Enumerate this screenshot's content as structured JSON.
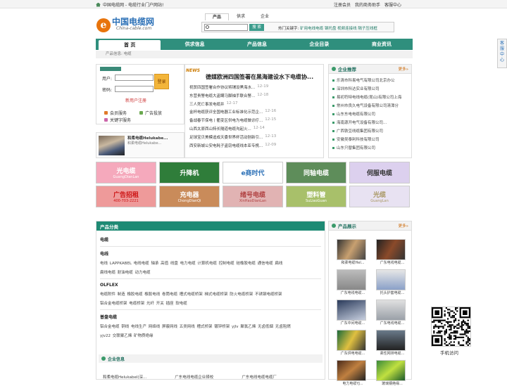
{
  "topbar": {
    "site": "中国电缆网 - 电缆行业门户网站!",
    "register": "注册会员",
    "my_business": "我的商务助手",
    "service": "客服中心"
  },
  "logo": {
    "cn": "中国电缆网",
    "en": "China-cable.com",
    "mark": "e"
  },
  "search": {
    "tabs": [
      "产品",
      "供求",
      "企业"
    ],
    "button": "搜 索",
    "hot_label": "热门关键字:",
    "hot_words": "矿用电线电缆 钢托盘 视频连接线 隔子压线框"
  },
  "nav": [
    "首 页",
    "供求信息",
    "产品信息",
    "企业目录",
    "商业资讯"
  ],
  "breadcrumb": "产品信息: 电缆",
  "login": {
    "user_label": "用户:",
    "pass_label": "密码:",
    "login_button": "登录",
    "register_link": "新用户注册",
    "services": [
      "会员服务",
      "广告投放",
      "关键字服务"
    ]
  },
  "product_card": {
    "name": "和柔电缆Helukabe...",
    "desc": "和柔电缆Helukabe..."
  },
  "news": {
    "tag": "NEWS",
    "headline": "德媒欧洲四国签署在黑海建设水下电缆协...",
    "items": [
      {
        "title": "祝贺四国签署合作协议将铺设黑海水...",
        "date": "12-19"
      },
      {
        "title": "东营贵警电缆大盗瞒马脚袖手联合警...",
        "date": "12-18"
      },
      {
        "title": "三人死亡事发电缆井",
        "date": "12-17"
      },
      {
        "title": "金杯电缆获评全国电器工业标准化示范企...",
        "date": "12-16"
      },
      {
        "title": "备战春节保电丨衢变区供电为电缆做诊疗...",
        "date": "12-15"
      },
      {
        "title": "山西太原西山特长隧道电缆沟起火...",
        "date": "12-14"
      },
      {
        "title": "足球宝贝美模追成天委世界杯活动刨新引...",
        "date": "12-13"
      },
      {
        "title": "西安新城公安电耗子盗窃电缆线本亚专携...",
        "date": "12-09"
      }
    ]
  },
  "recommend": {
    "title": "企业推荐",
    "more": "更多»",
    "items": [
      "乐清市科易电气有限公司北京办公",
      "深圳市科达实业有限公司",
      "易初符特电线电缆(昆山)有限公司上海",
      "常州市良久电气设备有限公司清潭分",
      "山东东电电缆有限公司",
      "海南源开电气设备有限公司...",
      "广西铁豆线缆集团有限公司",
      "安徽吴泰利科技有限公司",
      "山东只替集团有限公司"
    ]
  },
  "banners": [
    {
      "text": "光电缆",
      "sub": "GuangDianLan",
      "bg": "#f5a9bc",
      "fg": "#ffffff"
    },
    {
      "text": "升降机",
      "sub": "",
      "bg": "#2f7d3a",
      "fg": "#ffffff"
    },
    {
      "text": "e商时代",
      "sub": "",
      "bg": "#ffffff",
      "fg": "#2a6fb6"
    },
    {
      "text": "同轴电缆",
      "sub": "",
      "bg": "#5e8d5a",
      "fg": "#ffffff"
    },
    {
      "text": "伺服电缆",
      "sub": "",
      "bg": "#dcd0ee",
      "fg": "#333333"
    },
    {
      "text": "广告招租",
      "sub": "400-703-2221",
      "bg": "#ee9a9a",
      "fg": "#cc1111"
    },
    {
      "text": "充电器",
      "sub": "ChongDianQi",
      "bg": "#c98b5a",
      "fg": "#ffffff"
    },
    {
      "text": "绪号电缆",
      "sub": "XinHaoDianLan",
      "bg": "#e1b3b3",
      "fg": "#b04040"
    },
    {
      "text": "塑料管",
      "sub": "SuLiaoGuan",
      "bg": "#a8c06a",
      "fg": "#ffffff"
    },
    {
      "text": "光缆",
      "sub": "GuangLan",
      "bg": "#e8e2f2",
      "fg": "#aa9966"
    }
  ],
  "categories": {
    "title": "产品分类",
    "groups": [
      {
        "name": "电缆",
        "lines": []
      },
      {
        "name": "电线",
        "lines": [
          "电线 LAPPKABEL 电线电缆 轴承 高值 线盘 电力电缆 计算机电缆 控制电缆 硅橡胶电缆 通信电缆 扁线",
          "扁线电缆 耐油电缆 动力电缆"
        ]
      },
      {
        "name": "OLFLEX",
        "lines": [
          "电缆附件 制造 橡胶电缆 橡胶电线 卷筒电缆 槽式电缆桥架 梯式电缆桥架 防火电缆桥架 不锈钢电缆桥架",
          "铝合金电缆桥架 电缆桥架 光纤 开关 插座 软电缆"
        ]
      },
      {
        "name": "普盘电缆",
        "lines": [
          "铝合金电缆 铜线 电线生产 网络线 屏蔽网线 五类网线 槽式桥架 镀锌桥架 yjlv 聚氯乙烯 无卤低烟 无卤阻燃",
          "yjv22 交联聚乙烯 矿物质绝缘"
        ]
      }
    ]
  },
  "company_info": {
    "title": "企业信息",
    "items": [
      "和柔电缆Helukabel(深...",
      "广东电线电缆企业择校",
      "广东电线电缆电缆厂"
    ]
  },
  "products": {
    "title": "产品展示",
    "more": "更多»",
    "items": [
      "和柔电缆Hel...",
      "广东电线电缆...",
      "广东电线电缆...",
      "托头护套电缆...",
      "广东中间电缆...",
      "广东电线电缆...",
      "广东供电电缆...",
      "柔性网排电缆...",
      "电力电缆YJ...",
      "玻璃钢绝缘..."
    ]
  },
  "qr": {
    "label": "手机访问"
  },
  "sidetab": {
    "text": "客服中心"
  },
  "colors": {
    "brand_green": "#2f8f7d",
    "logo_blue": "#2a6fb6",
    "logo_orange": "#e8740c"
  }
}
